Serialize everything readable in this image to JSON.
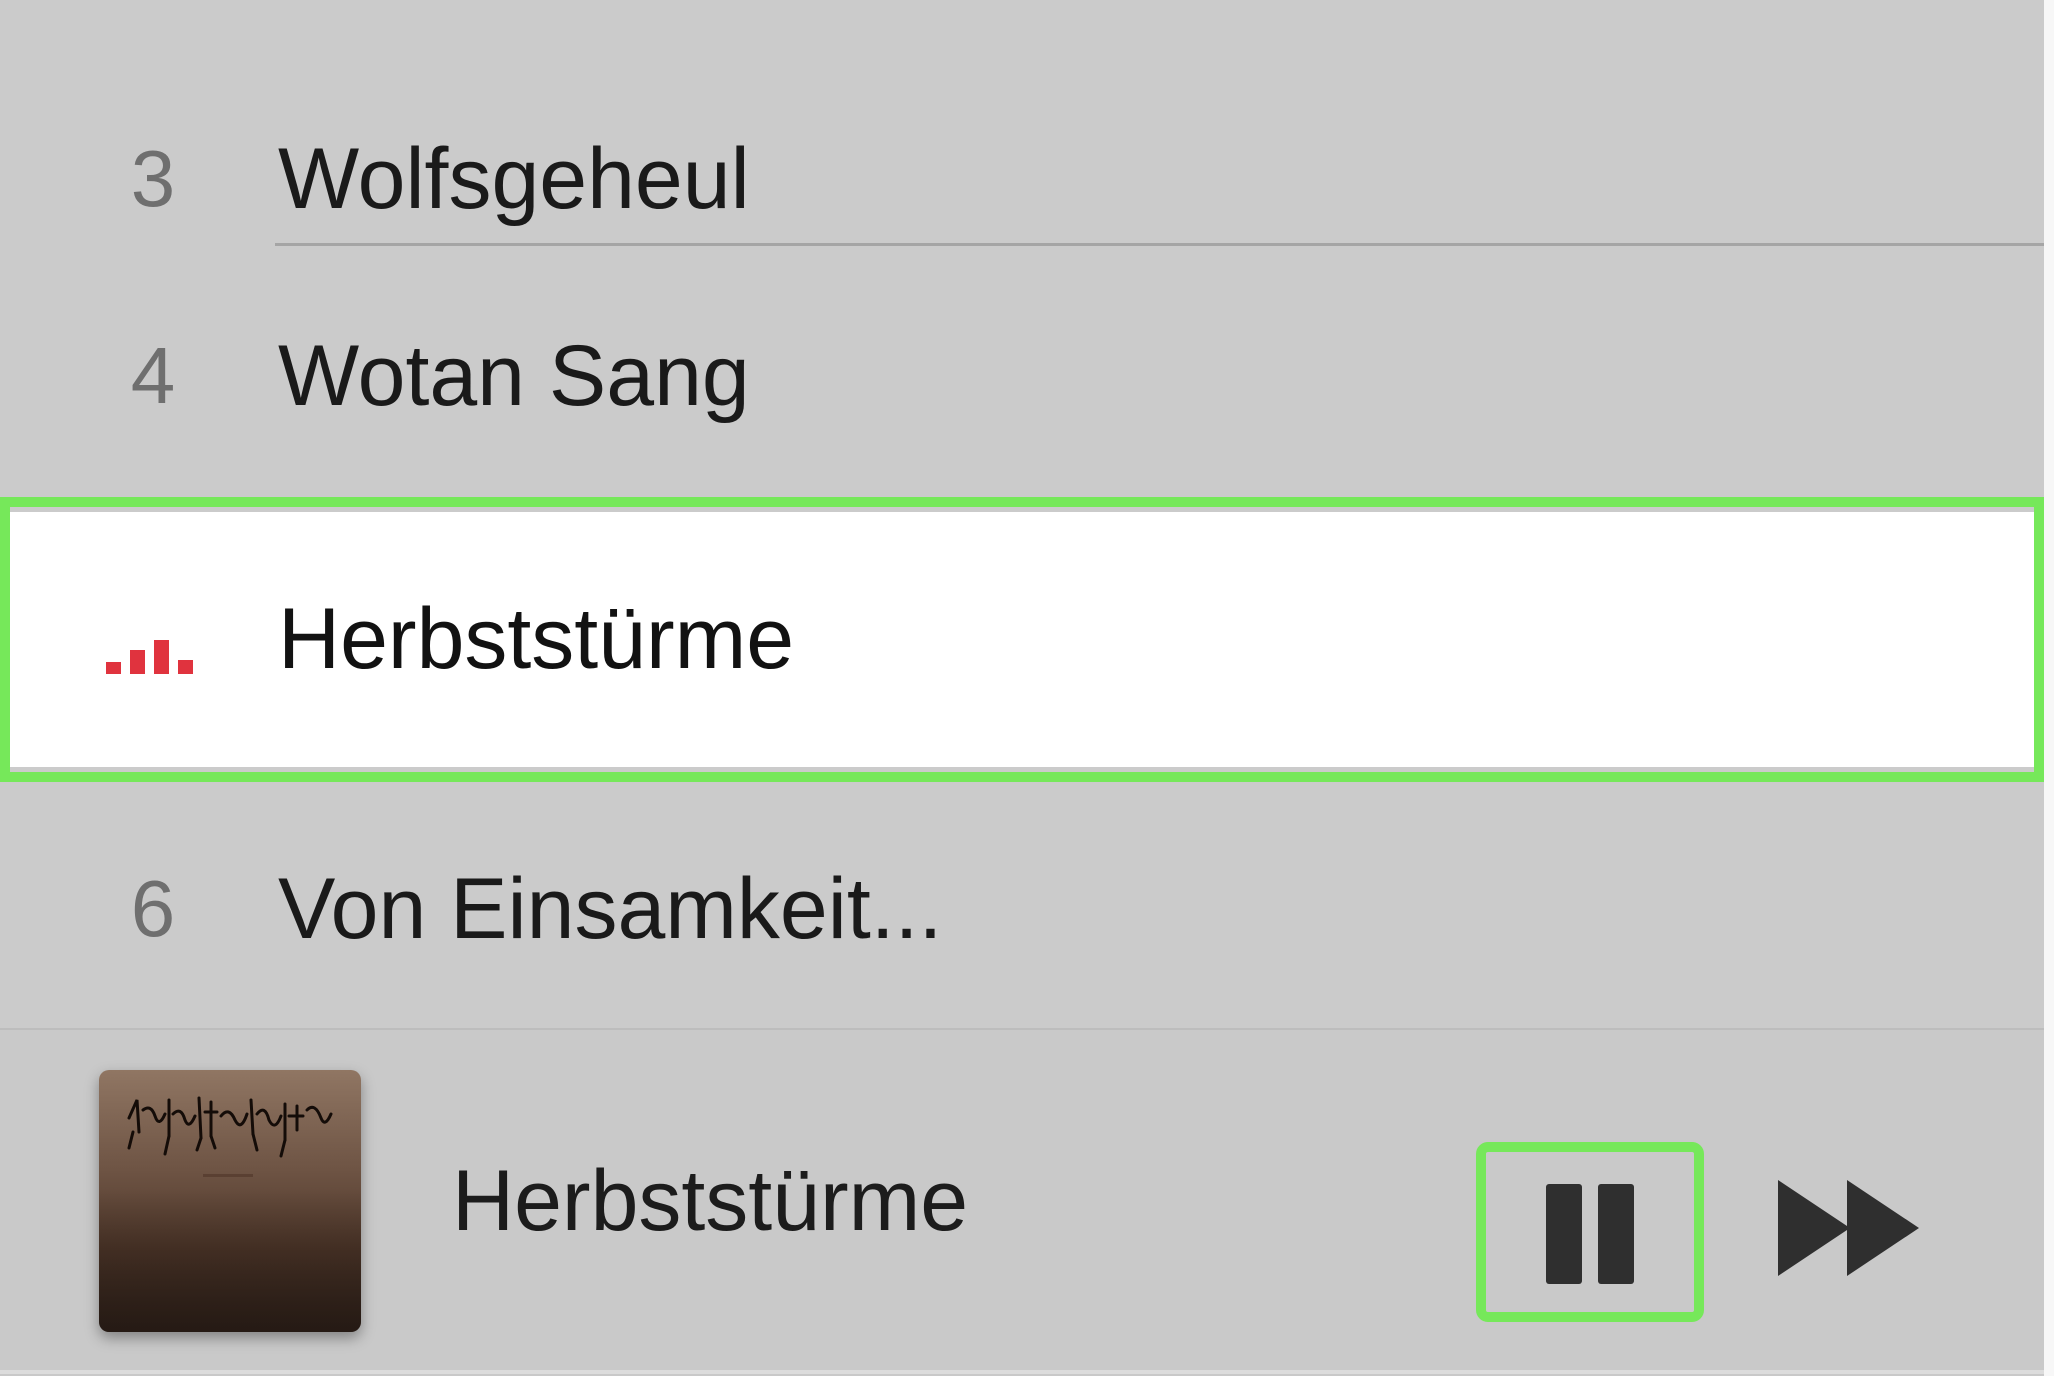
{
  "tracks": [
    {
      "number": "3",
      "title": "Wolfsgeheul"
    },
    {
      "number": "4",
      "title": "Wotan Sang"
    },
    {
      "number": "",
      "title": "Herbststürme",
      "now_playing": true
    },
    {
      "number": "6",
      "title": "Von Einsamkeit..."
    }
  ],
  "now_playing_indicator": {
    "icon": "equalizer-bars-icon",
    "color": "#e0333e",
    "levels": [
      0.35,
      0.7,
      1.0,
      0.4
    ]
  },
  "mini_player": {
    "title": "Herbststürme",
    "artwork": "album-artwork",
    "pause_icon": "pause-icon",
    "skip_icon": "fast-forward-icon"
  },
  "colors": {
    "highlight": "#76e85a",
    "list_background": "#cbcbcb",
    "current_row_background": "#ffffff"
  }
}
